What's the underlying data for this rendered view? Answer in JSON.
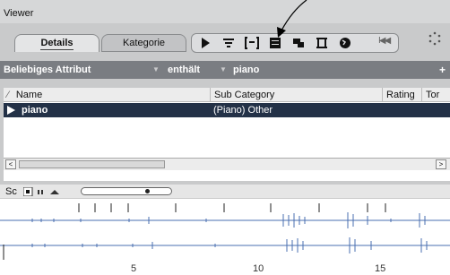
{
  "window": {
    "title": "Viewer"
  },
  "tabs": [
    {
      "label": "Details",
      "active": true
    },
    {
      "label": "Kategorie",
      "active": false
    }
  ],
  "toolbar": {
    "icons": [
      "play-icon",
      "list-icon",
      "bracket-list-icon",
      "details-icon",
      "stack-icon",
      "film-icon",
      "globe-icon",
      "rewind-icon",
      "dots-icon"
    ],
    "rewind_label": "I◀◀"
  },
  "filter": {
    "attribute": "Beliebiges Attribut",
    "operator": "enthält",
    "value": "piano",
    "add_label": "+"
  },
  "table": {
    "columns": [
      "Name",
      "Sub Category",
      "Rating",
      "Tor"
    ],
    "rows": [
      {
        "name": "piano",
        "sub_category": "(Piano) Other"
      }
    ]
  },
  "scroll": {
    "left_arrow": "<",
    "right_arrow": ">"
  },
  "waveform": {
    "label": "Sc",
    "ruler": [
      "5",
      "10",
      "15"
    ],
    "colors": {
      "wave": "#4a6fb0",
      "selected_row": "#233147"
    }
  }
}
